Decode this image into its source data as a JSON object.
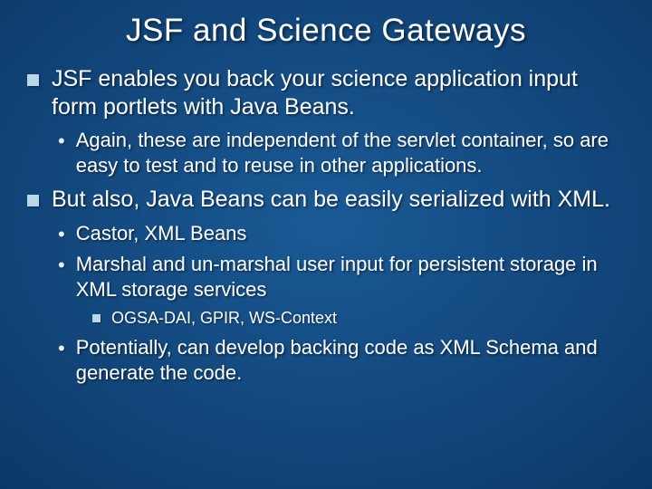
{
  "title": "JSF and Science Gateways",
  "bullets": [
    {
      "text": "JSF enables you back your science application input form portlets with Java Beans.",
      "sub": [
        {
          "text": "Again, these are independent of the servlet container, so are easy to test and to reuse in other applications.",
          "sub": []
        }
      ]
    },
    {
      "text": "But also, Java Beans can be easily serialized with XML.",
      "sub": [
        {
          "text": "Castor, XML Beans",
          "sub": []
        },
        {
          "text": "Marshal and un-marshal user input for persistent storage in XML storage services",
          "sub": [
            {
              "text": "OGSA-DAI, GPIR, WS-Context"
            }
          ]
        },
        {
          "text": "Potentially, can develop backing code as XML Schema and generate the code.",
          "sub": []
        }
      ]
    }
  ]
}
